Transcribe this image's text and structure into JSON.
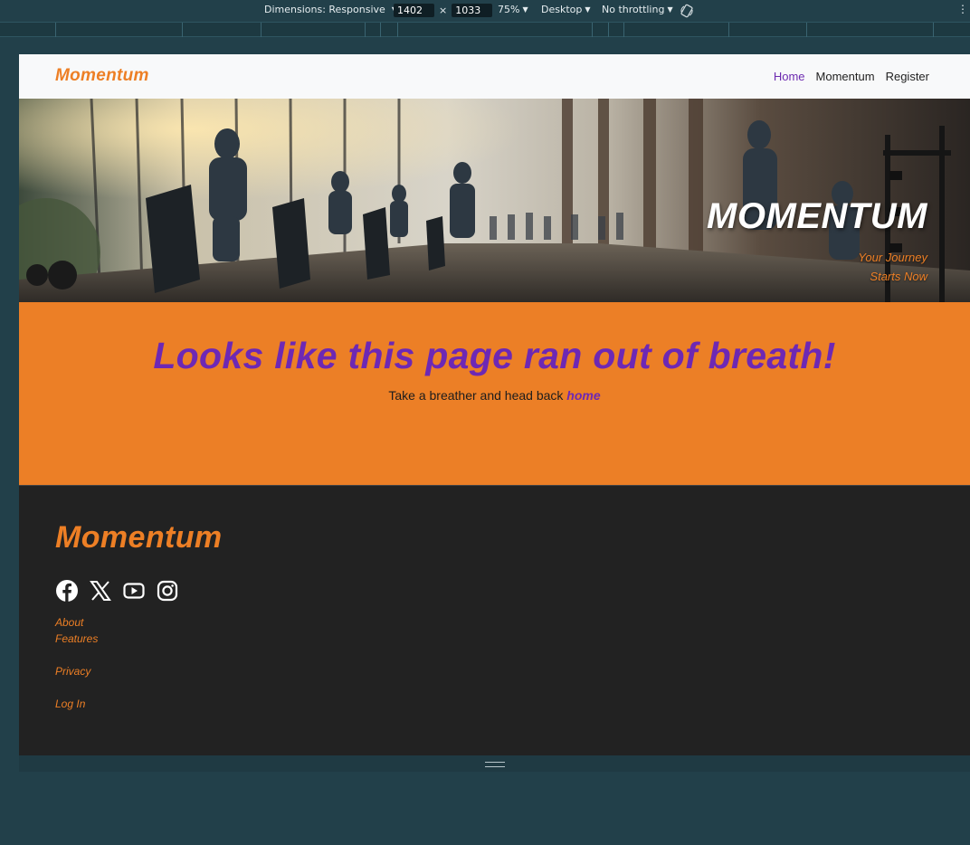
{
  "devtools": {
    "dimensions_label": "Dimensions: Responsive",
    "width": "1402",
    "height": "1033",
    "times": "×",
    "zoom": "75%",
    "device": "Desktop",
    "throttling": "No throttling"
  },
  "navbar": {
    "brand": "Momentum",
    "links": [
      {
        "label": "Home",
        "active": true
      },
      {
        "label": "Momentum",
        "active": false
      },
      {
        "label": "Register",
        "active": false
      }
    ]
  },
  "hero": {
    "title": "MOMENTUM",
    "subtitle_line1": "Your Journey",
    "subtitle_line2": "Starts Now"
  },
  "error_section": {
    "heading": "Looks like this page ran out of breath!",
    "message": "Take a breather and head back ",
    "link_text": "home"
  },
  "footer": {
    "brand": "Momentum",
    "social_icons": [
      "facebook-icon",
      "x-icon",
      "youtube-icon",
      "instagram-icon"
    ],
    "links": [
      "About",
      "Features",
      "Privacy",
      "Log In"
    ]
  },
  "colors": {
    "accent_orange": "#ec7f26",
    "accent_purple": "#6d28b4",
    "footer_bg": "#222222",
    "navbar_bg": "#f8f9fa"
  }
}
